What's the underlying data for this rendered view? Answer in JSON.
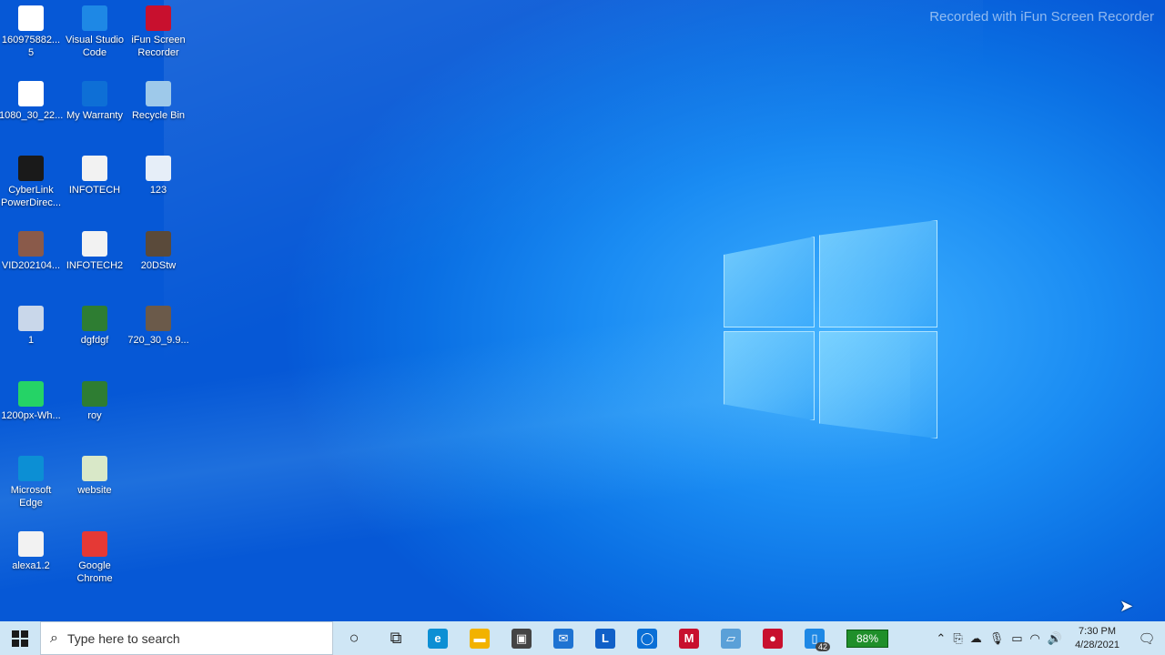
{
  "watermark": "Recorded with iFun Screen Recorder",
  "desktop_icons": [
    {
      "label": "160975882...\n5",
      "icon": "document-icon",
      "color": "#ffffff"
    },
    {
      "label": "Visual Studio\nCode",
      "icon": "vscode-icon",
      "color": "#1e88e5"
    },
    {
      "label": "iFun Screen\nRecorder",
      "icon": "recorder-icon",
      "color": "#c8102e"
    },
    {
      "label": "1080_30_22...",
      "icon": "video-file-icon",
      "color": "#ffffff"
    },
    {
      "label": "My Warranty",
      "icon": "warranty-icon",
      "color": "#0e6fd6"
    },
    {
      "label": "Recycle Bin",
      "icon": "recycle-bin-icon",
      "color": "#9ec9ea"
    },
    {
      "label": "CyberLink\nPowerDirec...",
      "icon": "powerdirector-icon",
      "color": "#1a1a1a"
    },
    {
      "label": "INFOTECH",
      "icon": "text-file-icon",
      "color": "#f2f2f2"
    },
    {
      "label": "123",
      "icon": "word-file-icon",
      "color": "#e6eef8"
    },
    {
      "label": "VID202104...",
      "icon": "video-thumb-icon",
      "color": "#8a5a4a"
    },
    {
      "label": "INFOTECH2",
      "icon": "text-file-icon",
      "color": "#f2f2f2"
    },
    {
      "label": "20DStw",
      "icon": "image-thumb-icon",
      "color": "#5a4a3a"
    },
    {
      "label": "1",
      "icon": "image-file-icon",
      "color": "#c9d7ea"
    },
    {
      "label": "dgfdgf",
      "icon": "tree-icon",
      "color": "#2e7d32"
    },
    {
      "label": "720_30_9.9...",
      "icon": "video-thumb-icon",
      "color": "#6b5a4a"
    },
    {
      "label": "1200px-Wh...",
      "icon": "whatsapp-icon",
      "color": "#25d366"
    },
    {
      "label": "roy",
      "icon": "tree-icon",
      "color": "#2e7d32"
    },
    {
      "label": "Microsoft\nEdge",
      "icon": "edge-icon",
      "color": "#0c8fd4"
    },
    {
      "label": "website",
      "icon": "notepad-icon",
      "color": "#d9e8c8"
    },
    {
      "label": "alexa1.2",
      "icon": "text-file-icon",
      "color": "#f2f2f2"
    },
    {
      "label": "Google\nChrome",
      "icon": "chrome-icon",
      "color": "#e53935"
    }
  ],
  "taskbar": {
    "search_placeholder": "Type here to search",
    "pinned": [
      {
        "name": "cortana-icon",
        "glyph": "○",
        "bg": ""
      },
      {
        "name": "task-view-icon",
        "glyph": "⧉",
        "bg": ""
      },
      {
        "name": "edge-taskbar-icon",
        "glyph": "e",
        "bg": "#0c8fd4"
      },
      {
        "name": "file-explorer-icon",
        "glyph": "▬",
        "bg": "#f2b200"
      },
      {
        "name": "store-icon",
        "glyph": "▣",
        "bg": "#444444"
      },
      {
        "name": "mail-icon",
        "glyph": "✉",
        "bg": "#1e73d2"
      },
      {
        "name": "l-app-icon",
        "glyph": "L",
        "bg": "#1060c8"
      },
      {
        "name": "app-square-icon",
        "glyph": "◯",
        "bg": "#0a6fd6"
      },
      {
        "name": "mcafee-icon",
        "glyph": "M",
        "bg": "#c8102e"
      },
      {
        "name": "laptop-app-icon",
        "glyph": "▱",
        "bg": "#5aa0d8"
      },
      {
        "name": "recorder-taskbar-icon",
        "glyph": "●",
        "bg": "#c8102e"
      },
      {
        "name": "phone-app-icon",
        "glyph": "▯",
        "bg": "#1e88e5",
        "badge": "42"
      }
    ],
    "battery_percent": "88%",
    "tray_icons": [
      "chevron-up-icon",
      "usb-icon",
      "cloud-icon",
      "microphone-icon",
      "battery-icon",
      "wifi-icon",
      "speaker-icon"
    ],
    "time": "7:30 PM",
    "date": "4/28/2021"
  }
}
